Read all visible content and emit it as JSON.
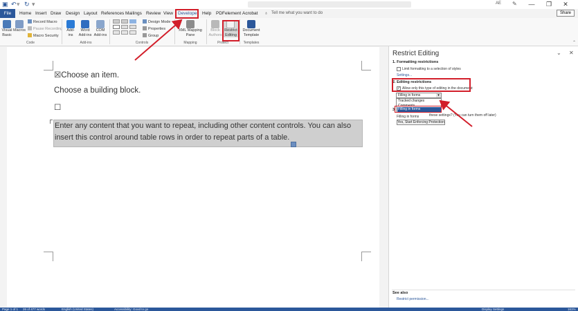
{
  "titlebar": {
    "undo_icon": "undo-icon",
    "redo_icon": "redo-icon",
    "user_initials": "AE"
  },
  "tabs": {
    "file": "File",
    "home": "Home",
    "insert": "Insert",
    "draw": "Draw",
    "design": "Design",
    "layout": "Layout",
    "references": "References",
    "mailings": "Mailings",
    "review": "Review",
    "view": "View",
    "developer": "Developer",
    "help": "Help",
    "pdfelement": "PDFelement",
    "acrobat": "Acrobat",
    "tellme": "Tell me what you want to do",
    "share": "Share"
  },
  "ribbon": {
    "code": {
      "visual_basic": "Visual Basic",
      "macros": "Macros",
      "record_macro": "Record Macro",
      "pause_recording": "Pause Recording",
      "macro_security": "Macro Security",
      "label": "Code"
    },
    "addins": {
      "addins": "Add-ins",
      "word_addins": "Word Add-ins",
      "com_addins": "COM Add-ins",
      "label": "Add-ins"
    },
    "controls": {
      "design_mode": "Design Mode",
      "properties": "Properties",
      "group": "Group",
      "label": "Controls"
    },
    "mapping": {
      "xml_mapping_pane": "XML Mapping Pane",
      "label": "Mapping"
    },
    "protect": {
      "block_authors": "Block Authors",
      "restrict_editing": "Restrict Editing",
      "label": "Protect"
    },
    "templates": {
      "document_template": "Document Template",
      "label": "Templates"
    }
  },
  "document": {
    "line1": "☒Choose an item.",
    "line2": "Choose a building block.",
    "line3": "☐",
    "repeat_line1": "Enter any content that you want to repeat, including other content controls. You can also",
    "repeat_line2": "insert this control around table rows in order to repeat parts of a table."
  },
  "pane": {
    "title": "Restrict Editing",
    "formatting_heading": "1. Formatting restrictions",
    "formatting_option": "Limit formatting to a selection of styles",
    "settings_link": "Settings...",
    "editing_heading": "2. Editing restrictions",
    "editing_option": "Allow only this type of editing in the document:",
    "dropdown_value": "Filling in forms",
    "options": [
      "Tracked changes",
      "Comments",
      "Filling in forms"
    ],
    "enforce_heading_num": "3",
    "enforce_hint": "these settings? (You can turn them off later)",
    "enforce_button": "Yes, Start Enforcing Protection",
    "see_also": "See also",
    "restrict_permission": "Restrict permission..."
  },
  "statusbar": {
    "page": "Page 1 of 1",
    "words": "26 of 477 words",
    "language": "English (United States)",
    "accessibility": "Accessibility: Good to go",
    "display_settings": "Display Settings",
    "zoom": "161%"
  },
  "colors": {
    "accent": "#2b579a",
    "annotation": "#d21e2a",
    "selection": "#cfcfcf"
  }
}
